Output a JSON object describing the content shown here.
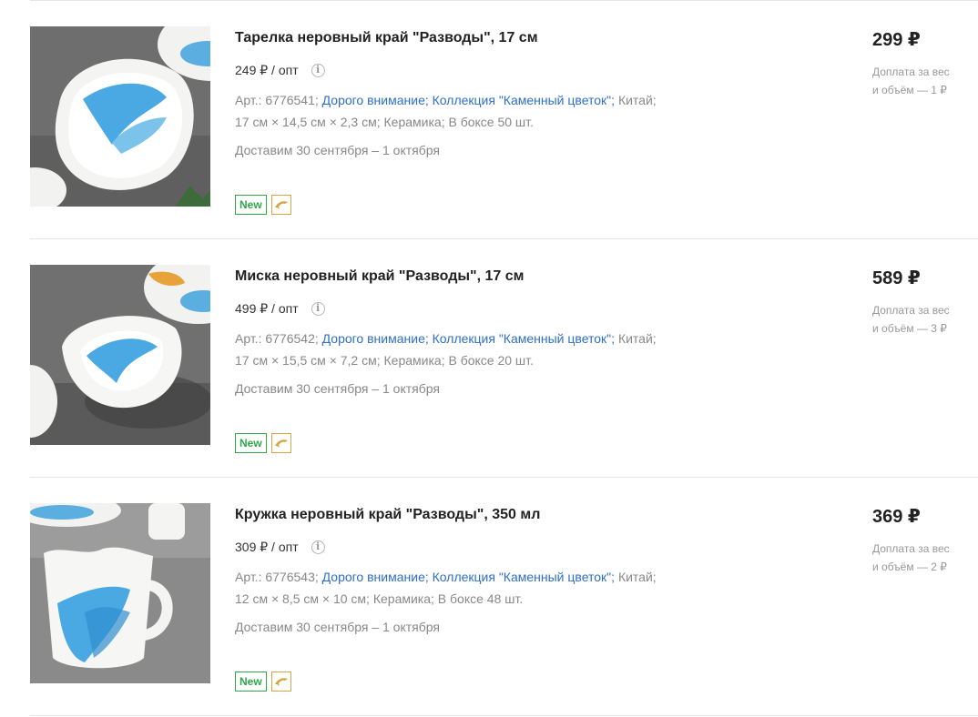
{
  "products": [
    {
      "title": "Тарелка неровный край \"Разводы\", 17 см",
      "opt_price": "249 ₽ / опт",
      "article": "Арт.: 6776541;",
      "brand_link": "Дорого внимание",
      "collection_link": "Коллекция \"Каменный цветок\"",
      "country": "Китай;",
      "specs": "17 см × 14,5 см × 2,3 см; Керамика; В боксе 50 шт.",
      "delivery": "Доставим 30 сентября – 1 октября",
      "badge": "New",
      "price": "299 ₽",
      "surcharge_line1": "Доплата за вес",
      "surcharge_line2": "и объём — 1 ₽"
    },
    {
      "title": "Миска неровный край \"Разводы\", 17 см",
      "opt_price": "499 ₽ / опт",
      "article": "Арт.: 6776542;",
      "brand_link": "Дорого внимание",
      "collection_link": "Коллекция \"Каменный цветок\"",
      "country": "Китай;",
      "specs": "17 см × 15,5 см × 7,2 см; Керамика; В боксе 20 шт.",
      "delivery": "Доставим 30 сентября – 1 октября",
      "badge": "New",
      "price": "589 ₽",
      "surcharge_line1": "Доплата за вес",
      "surcharge_line2": "и объём — 3 ₽"
    },
    {
      "title": "Кружка неровный край \"Разводы\", 350 мл",
      "opt_price": "309 ₽ / опт",
      "article": "Арт.: 6776543;",
      "brand_link": "Дорого внимание",
      "collection_link": "Коллекция \"Каменный цветок\"",
      "country": "Китай;",
      "specs": "12 см × 8,5 см × 10 см; Керамика; В боксе 48 шт.",
      "delivery": "Доставим 30 сентября – 1 октября",
      "badge": "New",
      "price": "369 ₽",
      "surcharge_line1": "Доплата за вес",
      "surcharge_line2": "и объём — 2 ₽"
    }
  ],
  "colors": {
    "link": "#2f6fc6",
    "new_badge": "#2ea84a",
    "dolphin_badge": "#d4a640",
    "secondary_text": "#888888"
  },
  "icons": {
    "info": "info-circle-icon",
    "dolphin": "dolphin-icon"
  }
}
